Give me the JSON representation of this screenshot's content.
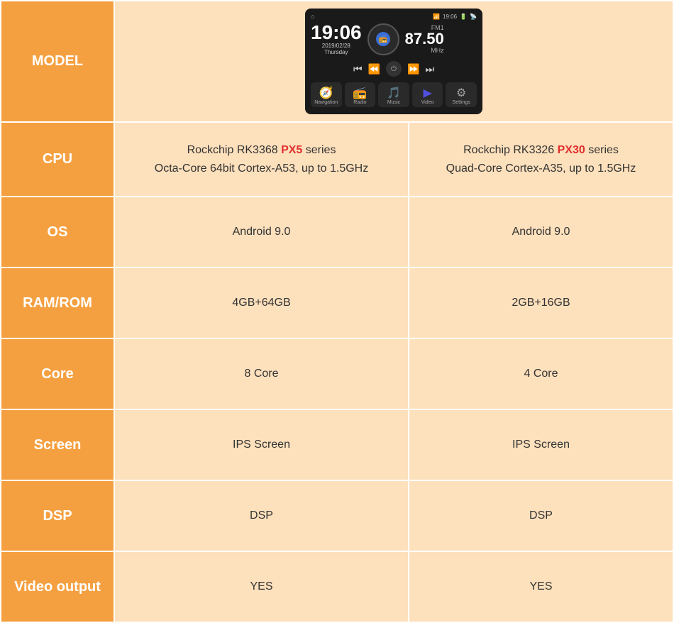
{
  "colors": {
    "orange": "#f5a040",
    "light_orange": "#fde0bc",
    "white": "#ffffff",
    "red": "#e03030"
  },
  "header": {
    "label": "MODEL",
    "device": {
      "time": "19:06",
      "date": "2019/02/28",
      "day": "Thursday",
      "fm_label": "FM1",
      "frequency": "87.50",
      "mhz": "MHz",
      "apps": [
        {
          "label": "Navigation",
          "icon": "🧭"
        },
        {
          "label": "Radio",
          "icon": "📻"
        },
        {
          "label": "Music",
          "icon": "🎵"
        },
        {
          "label": "Video",
          "icon": "▶"
        },
        {
          "label": "Settings",
          "icon": "⚙"
        }
      ]
    }
  },
  "rows": [
    {
      "label": "CPU",
      "col1_line1": "Rockchip RK3368 ",
      "col1_highlight": "PX5",
      "col1_line1_suffix": " series",
      "col1_line2": "Octa-Core 64bit Cortex-A53, up to 1.5GHz",
      "col2_line1": "Rockchip RK3326 ",
      "col2_highlight": "PX30",
      "col2_line1_suffix": " series",
      "col2_line2": "Quad-Core  Cortex-A35, up to 1.5GHz"
    },
    {
      "label": "OS",
      "col1": "Android 9.0",
      "col2": "Android 9.0"
    },
    {
      "label": "RAM/ROM",
      "col1": "4GB+64GB",
      "col2": "2GB+16GB"
    },
    {
      "label": "Core",
      "col1": "8 Core",
      "col2": "4 Core"
    },
    {
      "label": "Screen",
      "col1": "IPS Screen",
      "col2": "IPS Screen"
    },
    {
      "label": "DSP",
      "col1": "DSP",
      "col2": "DSP"
    },
    {
      "label": "Video output",
      "col1": "YES",
      "col2": "YES"
    }
  ]
}
